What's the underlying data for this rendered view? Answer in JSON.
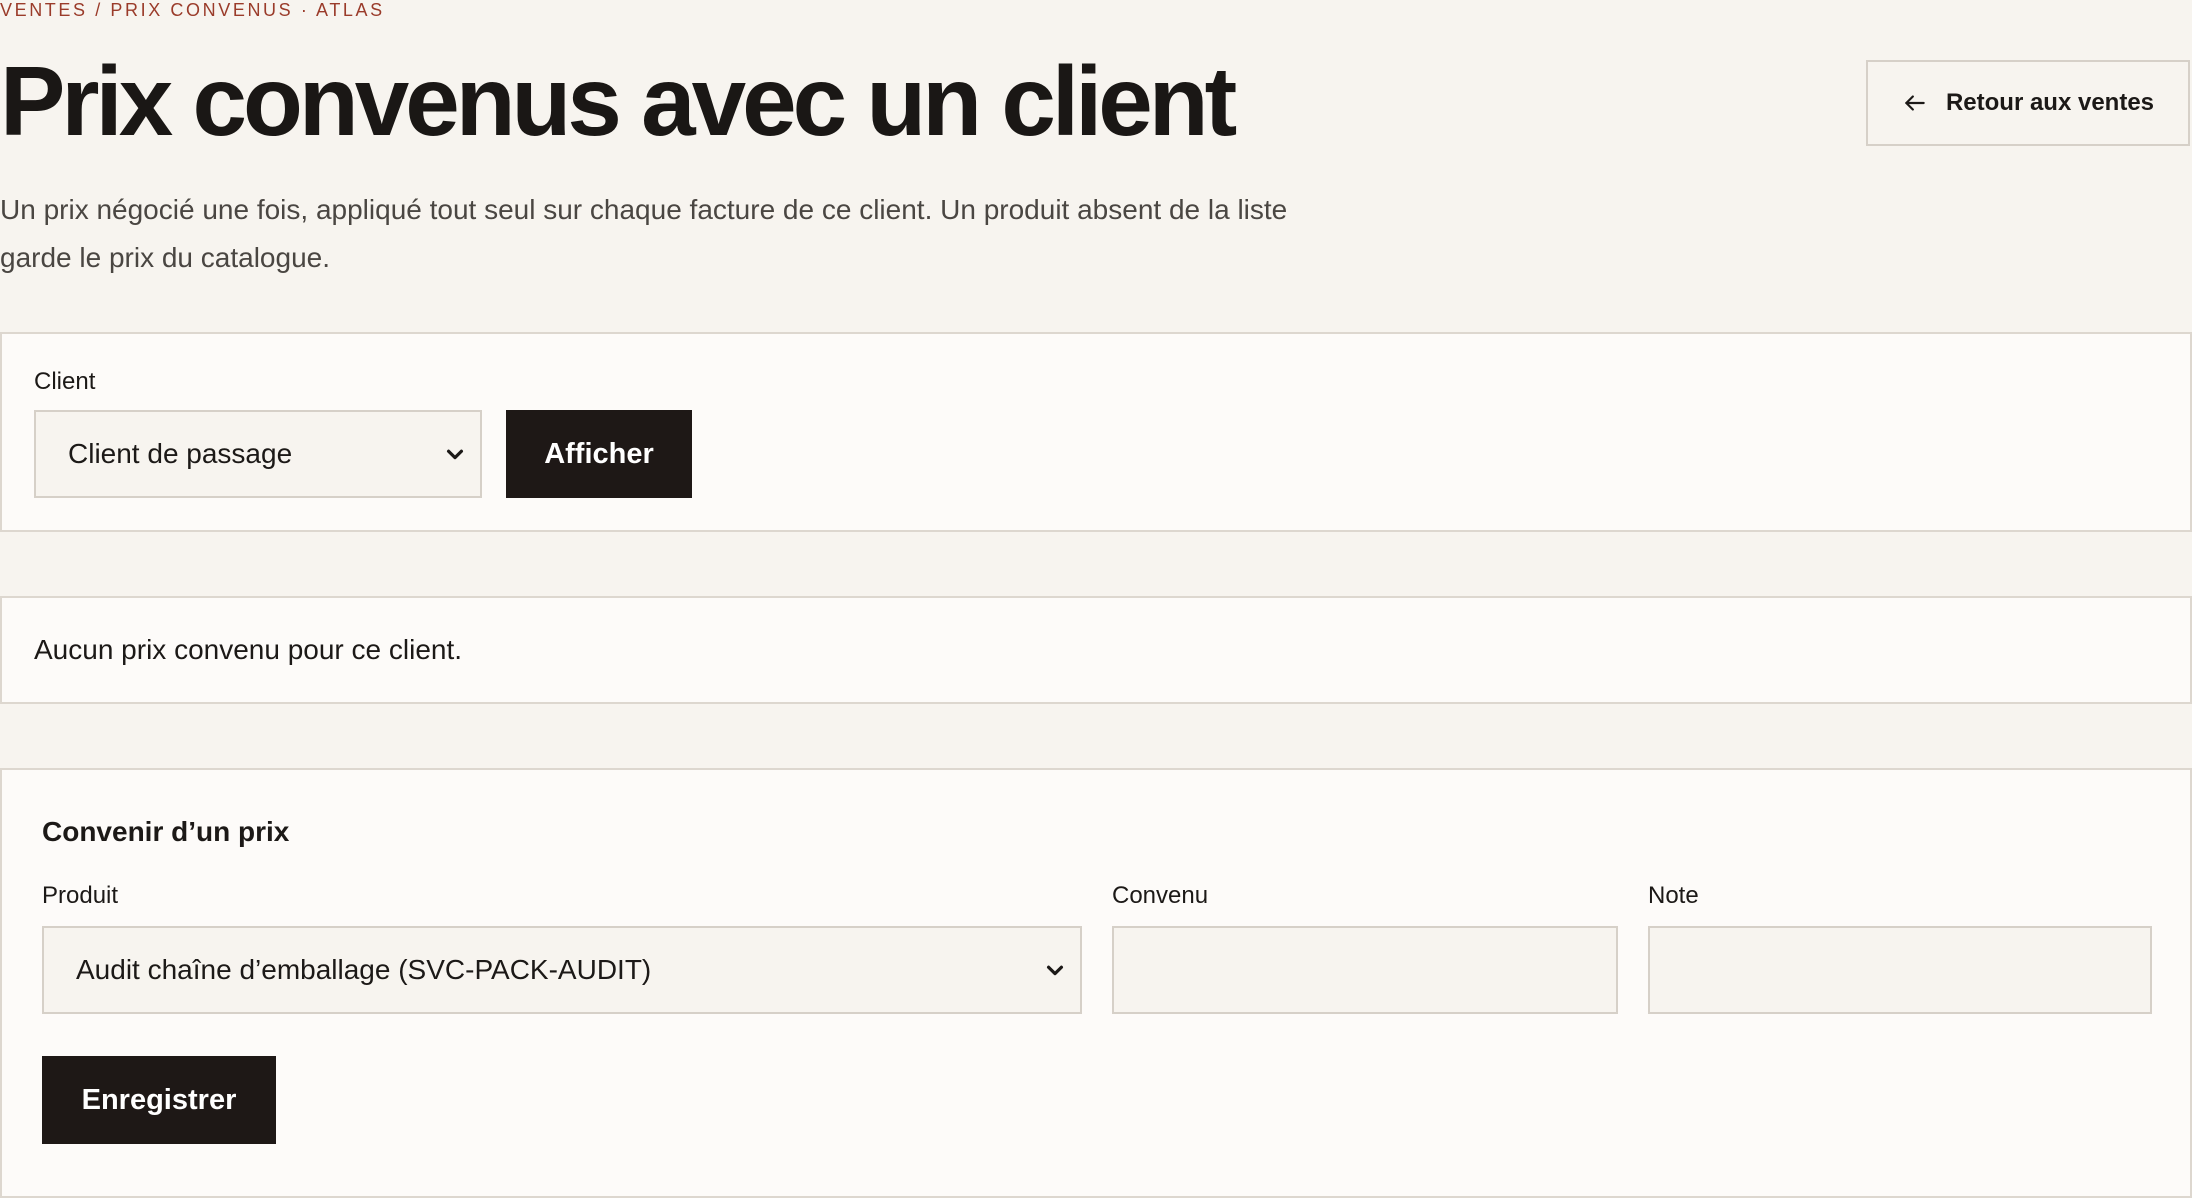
{
  "breadcrumb": "VENTES / PRIX CONVENUS · ATLAS",
  "title": "Prix convenus avec un client",
  "subtitle": "Un prix négocié une fois, appliqué tout seul sur chaque facture de ce client. Un produit absent de la liste garde le prix du catalogue.",
  "back_button": {
    "label": "Retour aux ventes",
    "icon": "arrow-left-icon"
  },
  "client_filter": {
    "label": "Client",
    "selected": "Client de passage",
    "submit_label": "Afficher"
  },
  "empty_state": "Aucun prix convenu pour ce client.",
  "agreement_form": {
    "heading": "Convenir d’un prix",
    "product_label": "Produit",
    "product_selected": "Audit chaîne d’emballage (SVC-PACK-AUDIT)",
    "agreed_label": "Convenu",
    "agreed_value": "",
    "note_label": "Note",
    "note_value": "",
    "save_label": "Enregistrer"
  },
  "colors": {
    "background": "#f7f4ef",
    "card": "#fdfbf9",
    "accent": "#9a3b2a",
    "button": "#1e1816",
    "border": "#ddd7cf"
  }
}
